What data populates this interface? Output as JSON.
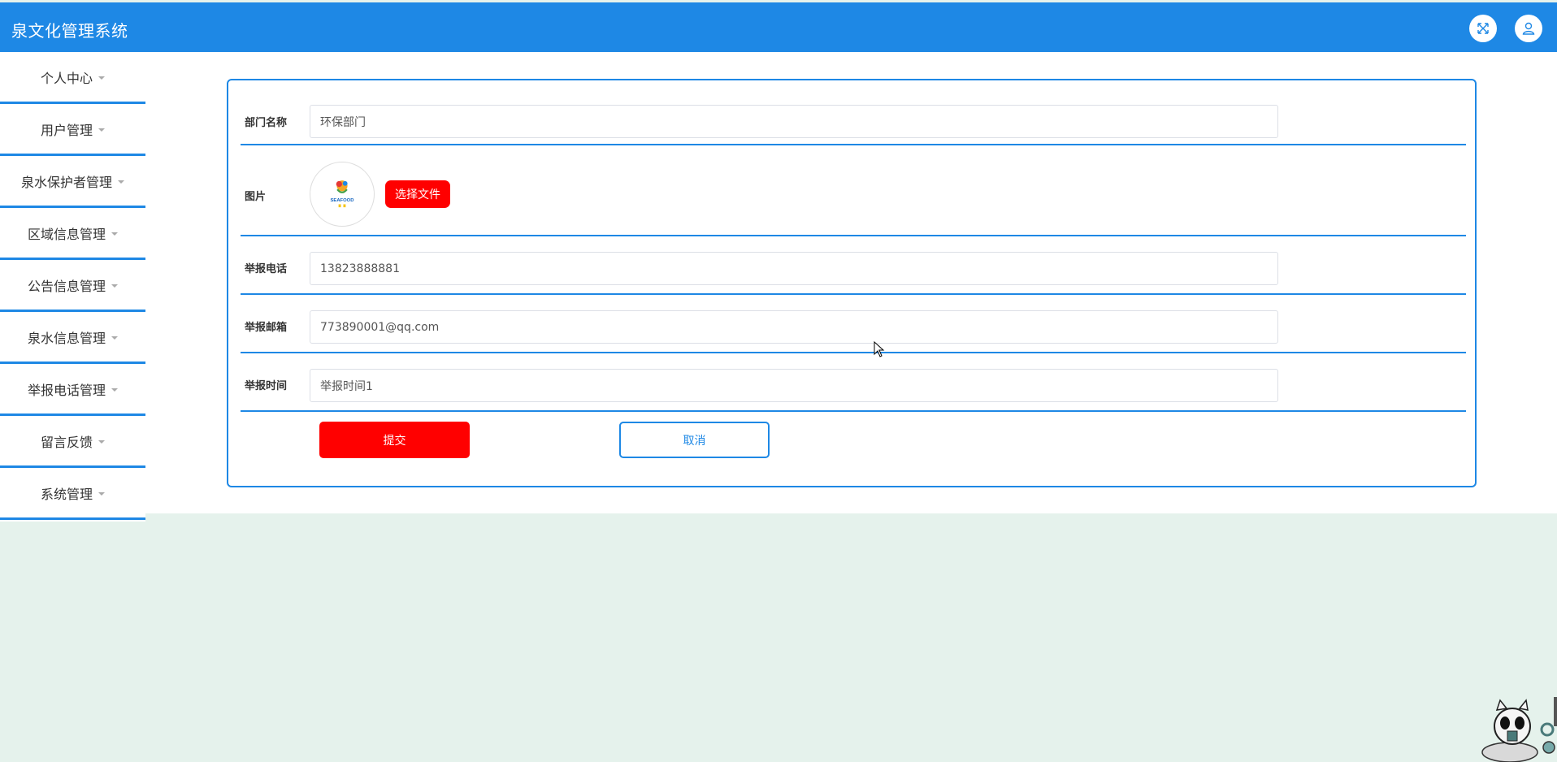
{
  "app": {
    "title": "泉文化管理系统"
  },
  "header_icons": [
    "fullscreen-icon",
    "user-icon"
  ],
  "sidebar": {
    "items": [
      {
        "label": "个人中心"
      },
      {
        "label": "用户管理"
      },
      {
        "label": "泉水保护者管理"
      },
      {
        "label": "区域信息管理"
      },
      {
        "label": "公告信息管理"
      },
      {
        "label": "泉水信息管理"
      },
      {
        "label": "举报电话管理"
      },
      {
        "label": "留言反馈"
      },
      {
        "label": "系统管理"
      }
    ]
  },
  "form": {
    "department": {
      "label": "部门名称",
      "value": "环保部门"
    },
    "image": {
      "label": "图片",
      "file_button": "选择文件",
      "logo_text": "SEAFOOD"
    },
    "phone": {
      "label": "举报电话",
      "value": "13823888881"
    },
    "email": {
      "label": "举报邮箱",
      "value": "773890001@qq.com"
    },
    "time": {
      "label": "举报时间",
      "value": "举报时间1"
    },
    "submit_label": "提交",
    "cancel_label": "取消"
  },
  "colors": {
    "primary": "#1e88e5",
    "danger": "#ff0000",
    "page_bg": "#e5f2ec"
  }
}
